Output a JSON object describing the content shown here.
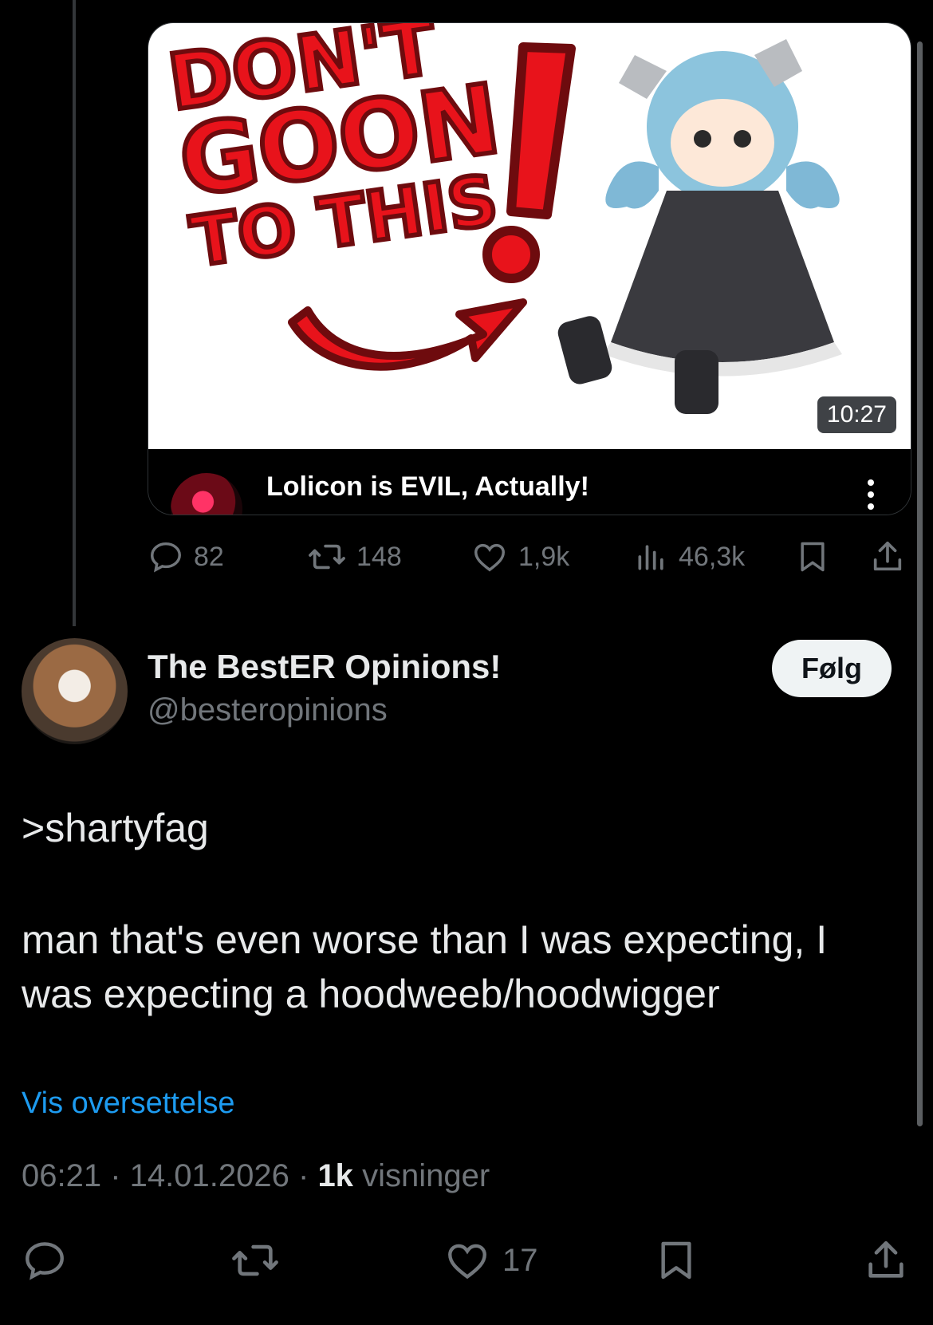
{
  "embed": {
    "thumbnail_text": [
      "DON'T",
      "GOON",
      "TO THIS"
    ],
    "duration": "10:27",
    "title": "Lolicon is EVIL, Actually!"
  },
  "parent_stats": {
    "replies": "82",
    "reposts": "148",
    "likes": "1,9k",
    "views": "46,3k"
  },
  "author": {
    "name": "The BestER Opinions!",
    "handle": "@besteropinions",
    "follow_label": "Følg"
  },
  "tweet": {
    "line1": ">shartyfag",
    "line2": "man that's even worse than I was expecting, I",
    "line3": "was expecting a hoodweeb/hoodwigger",
    "translate_label": "Vis oversettelse",
    "time": "06:21",
    "date": "14.01.2026",
    "views_count": "1k",
    "views_label": "visninger"
  },
  "actions": {
    "likes": "17"
  },
  "colors": {
    "background": "#000000",
    "text": "#e7e9ea",
    "muted": "#71767b",
    "link": "#1d9bf0",
    "thumb_red": "#e8131b"
  }
}
